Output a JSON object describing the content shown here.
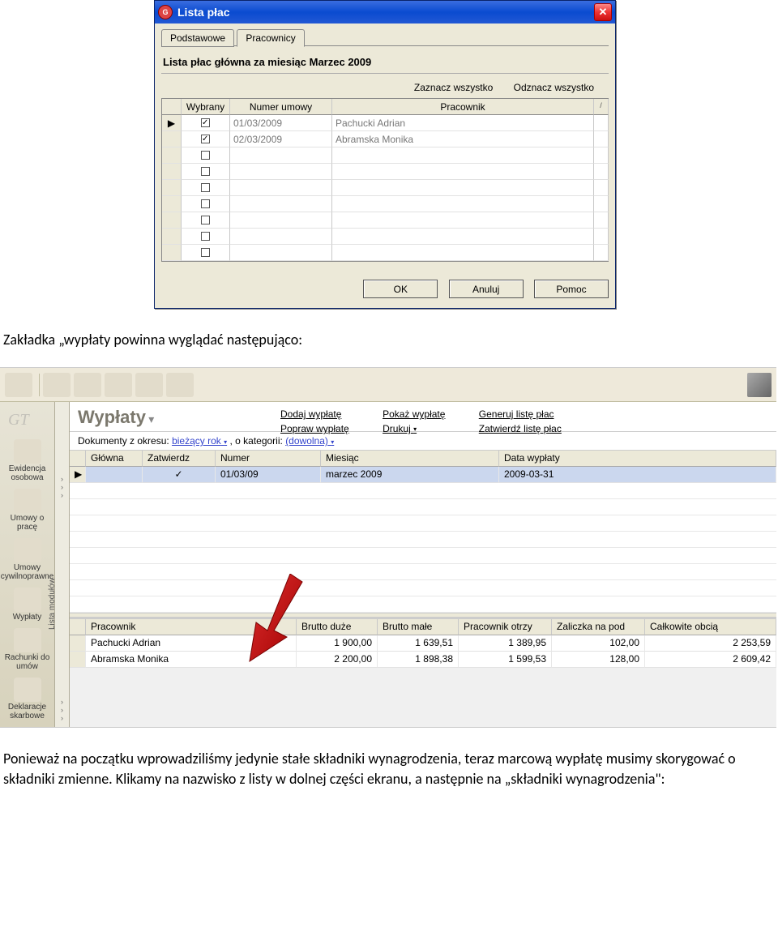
{
  "dialog": {
    "title": "Lista płac",
    "tabs": {
      "basic": "Podstawowe",
      "employees": "Pracownicy"
    },
    "subtitle": "Lista płac główna za miesiąc Marzec 2009",
    "links": {
      "select_all": "Zaznacz wszystko",
      "deselect_all": "Odznacz wszystko"
    },
    "grid_headers": {
      "selected": "Wybrany",
      "contract_no": "Numer umowy",
      "employee": "Pracownik",
      "sort": "/"
    },
    "rows": [
      {
        "checked": true,
        "marker": "▶",
        "contract": "01/03/2009",
        "employee": "Pachucki Adrian"
      },
      {
        "checked": true,
        "marker": "",
        "contract": "02/03/2009",
        "employee": "Abramska Monika"
      },
      {
        "checked": false,
        "marker": "",
        "contract": "",
        "employee": ""
      },
      {
        "checked": false,
        "marker": "",
        "contract": "",
        "employee": ""
      },
      {
        "checked": false,
        "marker": "",
        "contract": "",
        "employee": ""
      },
      {
        "checked": false,
        "marker": "",
        "contract": "",
        "employee": ""
      },
      {
        "checked": false,
        "marker": "",
        "contract": "",
        "employee": ""
      },
      {
        "checked": false,
        "marker": "",
        "contract": "",
        "employee": ""
      },
      {
        "checked": false,
        "marker": "",
        "contract": "",
        "employee": ""
      }
    ],
    "buttons": {
      "ok": "OK",
      "cancel": "Anuluj",
      "help": "Pomoc"
    }
  },
  "doc_text": {
    "line1": "Zakładka „wypłaty powinna wyglądać następująco:",
    "line2a": "Ponieważ na początku wprowadziliśmy jedynie stałe składniki wynagrodzenia, teraz marcową wypłatę musimy skorygować o składniki zmienne. Klikamy na nazwisko z listy w dolnej części ekranu, a następnie na „składniki wynagrodzenia\":"
  },
  "app": {
    "sidebar_vlabel": "Lista modułów",
    "nav": {
      "ewidencja": "Ewidencja osobowa",
      "umowy_prace": "Umowy o pracę",
      "umowy_cyw": "Umowy cywilnoprawne",
      "wyplaty": "Wypłaty",
      "rachunki": "Rachunki do umów",
      "deklaracje": "Deklaracje skarbowe"
    },
    "title": "Wypłaty",
    "title_arrow": "▾",
    "actions": {
      "dodaj": "Dodaj wypłatę",
      "popraw": "Popraw wypłatę",
      "pokaz": "Pokaż wypłatę",
      "drukuj": "Drukuj",
      "generuj": "Generuj listę płac",
      "zatwierdz": "Zatwierdź listę płac",
      "drop": "▾"
    },
    "filter": {
      "label1": "Dokumenty z okresu:",
      "val1": "bieżący rok",
      "label2": ", o kategorii:",
      "val2": "(dowolna)",
      "drop": "▾"
    },
    "grid_headers": {
      "glowna": "Główna",
      "zatwierdz": "Zatwierdz",
      "numer": "Numer",
      "miesiac": "Miesiąc",
      "data": "Data wypłaty"
    },
    "grid_row": {
      "marker": "▶",
      "zatw": "✓",
      "numer": "01/03/09",
      "miesiac": "marzec 2009",
      "data": "2009-03-31"
    },
    "lower_headers": {
      "pracownik": "Pracownik",
      "brutto_duze": "Brutto duże",
      "brutto_male": "Brutto małe",
      "prac_otrzy": "Pracownik otrzy",
      "zaliczka": "Zaliczka na pod",
      "calkowite": "Całkowite obcią"
    },
    "lower_rows": [
      {
        "name": "Pachucki Adrian",
        "bd": "1 900,00",
        "bm": "1 639,51",
        "po": "1 389,95",
        "zp": "102,00",
        "co": "2 253,59"
      },
      {
        "name": "Abramska Monika",
        "bd": "2 200,00",
        "bm": "1 898,38",
        "po": "1 599,53",
        "zp": "128,00",
        "co": "2 609,42"
      }
    ]
  }
}
